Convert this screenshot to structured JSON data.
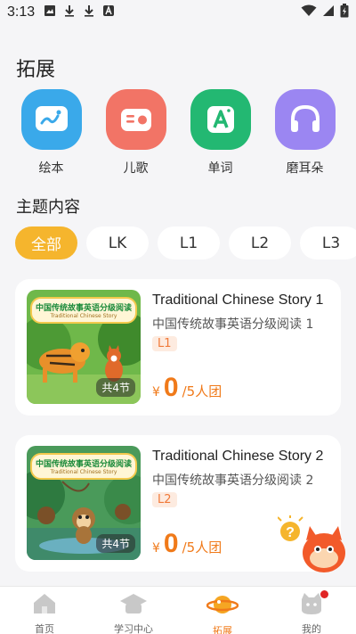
{
  "status_bar": {
    "time": "3:13"
  },
  "page": {
    "title": "拓展"
  },
  "quick_entries": [
    {
      "label": "绘本",
      "icon": "picture-book-icon",
      "color": "#3aa9ea"
    },
    {
      "label": "儿歌",
      "icon": "radio-icon",
      "color": "#f27466"
    },
    {
      "label": "单词",
      "icon": "word-card-icon",
      "color": "#23b872"
    },
    {
      "label": "磨耳朵",
      "icon": "headphones-icon",
      "color": "#9b86f2"
    }
  ],
  "section": {
    "title": "主题内容"
  },
  "filters": {
    "active": "全部",
    "chips": [
      "全部",
      "LK",
      "L1",
      "L2",
      "L3"
    ]
  },
  "courses": [
    {
      "title": "Traditional Chinese Story 1",
      "subtitle": "中国传统故事英语分级阅读 1",
      "level": "L1",
      "currency": "¥",
      "price": "0",
      "group": "/5人团",
      "lessons": "共4节",
      "thumb_title_cn": "中国传统故事英语分级阅读",
      "thumb_title_en": "Traditional Chinese Story"
    },
    {
      "title": "Traditional Chinese Story 2",
      "subtitle": "中国传统故事英语分级阅读 2",
      "level": "L2",
      "currency": "¥",
      "price": "0",
      "group": "/5人团",
      "lessons": "共4节",
      "thumb_title_cn": "中国传统故事英语分级阅读",
      "thumb_title_en": "Traditional Chinese Story"
    }
  ],
  "bottom_nav": [
    {
      "label": "首页",
      "icon": "home-icon",
      "active": false
    },
    {
      "label": "学习中心",
      "icon": "learning-center-icon",
      "active": false
    },
    {
      "label": "拓展",
      "icon": "planet-icon",
      "active": true
    },
    {
      "label": "我的",
      "icon": "profile-cat-icon",
      "active": false
    }
  ],
  "colors": {
    "accent": "#f5b52d",
    "price": "#f07a1a",
    "background": "#f5f5f7"
  }
}
